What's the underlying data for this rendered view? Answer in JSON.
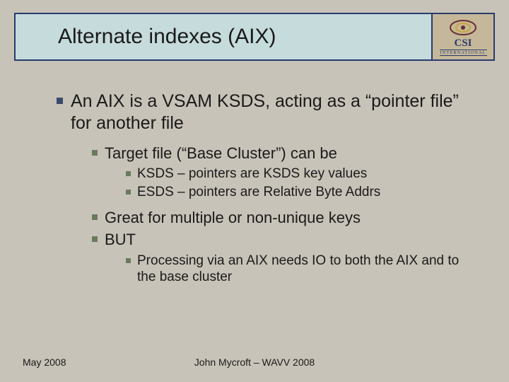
{
  "title": "Alternate indexes (AIX)",
  "logo": {
    "name": "CSI",
    "sub": "INTERNATIONAL"
  },
  "bullets": {
    "l1": "An AIX is a VSAM KSDS, acting as a “pointer file” for another file",
    "l2a": "Target file (“Base Cluster”) can be",
    "l3a": "KSDS – pointers are KSDS key values",
    "l3b": "ESDS – pointers are Relative Byte Addrs",
    "l2b": "Great for multiple or non-unique keys",
    "l2c": "BUT",
    "l3c": "Processing via an AIX needs IO to both the AIX and to the base cluster"
  },
  "footer": {
    "left": "May 2008",
    "center": "John Mycroft – WAVV 2008"
  }
}
